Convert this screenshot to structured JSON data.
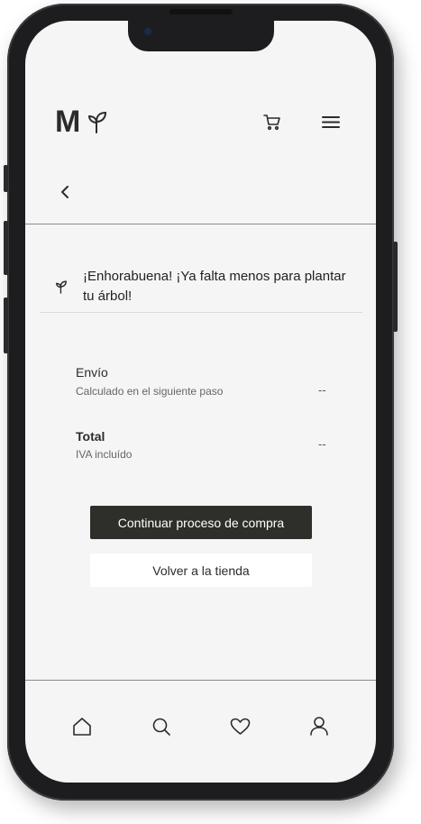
{
  "header": {
    "logo_letter": "M",
    "icons": {
      "logo": "sprout-icon",
      "cart": "cart-icon",
      "menu": "menu-icon"
    }
  },
  "nav": {
    "back_icon": "chevron-left-icon"
  },
  "banner": {
    "icon": "sprout-icon",
    "message": "¡Enhorabuena! ¡Ya falta menos para plantar tu árbol!"
  },
  "summary": {
    "shipping": {
      "label": "Envío",
      "sub": "Calculado en el siguiente paso",
      "value": "--"
    },
    "total": {
      "label": "Total",
      "sub": "IVA incluído",
      "value": "--"
    }
  },
  "actions": {
    "continue_label": "Continuar proceso de compra",
    "back_to_store_label": "Volver a la tienda"
  },
  "tabbar": {
    "items": [
      {
        "icon": "home-icon"
      },
      {
        "icon": "search-icon"
      },
      {
        "icon": "heart-icon"
      },
      {
        "icon": "user-icon"
      }
    ]
  },
  "colors": {
    "screen_bg": "#f5f5f5",
    "primary_button": "#2e2e2a",
    "text": "#2b2b2b"
  }
}
